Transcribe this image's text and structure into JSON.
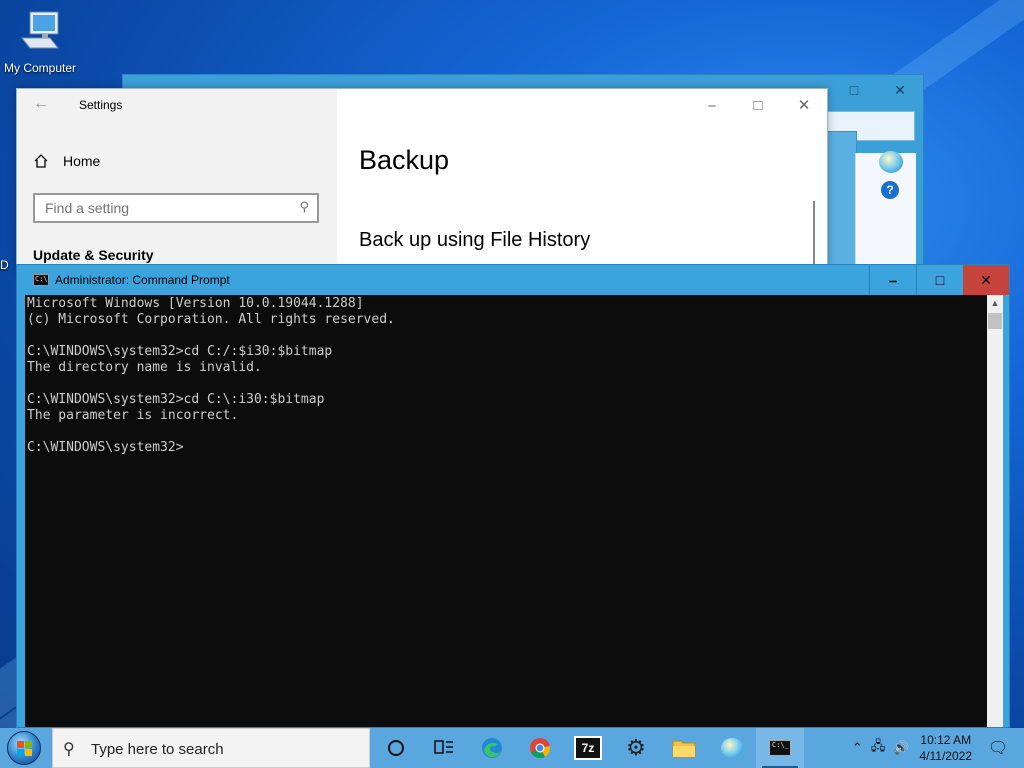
{
  "desktop": {
    "icons": [
      {
        "label": "My Computer",
        "icon": "computer-icon"
      }
    ],
    "partial_label": "D"
  },
  "background_window": {
    "icons": [
      "minimize-icon",
      "maximize-icon",
      "close-icon",
      "globe-icon",
      "help-icon"
    ],
    "help_glyph": "?"
  },
  "settings": {
    "title": "Settings",
    "nav_home": "Home",
    "search_placeholder": "Find a setting",
    "section": "Update & Security",
    "page_heading": "Backup",
    "subheading": "Back up using File History"
  },
  "cmd": {
    "title": "Administrator: Command Prompt",
    "lines": [
      "Microsoft Windows [Version 10.0.19044.1288]",
      "(c) Microsoft Corporation. All rights reserved.",
      "",
      "C:\\WINDOWS\\system32>cd C:/:$i30:$bitmap",
      "The directory name is invalid.",
      "",
      "C:\\WINDOWS\\system32>cd C:\\:i30:$bitmap",
      "The parameter is incorrect.",
      "",
      "C:\\WINDOWS\\system32>"
    ]
  },
  "taskbar": {
    "search_placeholder": "Type here to search",
    "pinned": [
      {
        "name": "cortana",
        "icon": "circle-icon"
      },
      {
        "name": "task-view",
        "icon": "task-view-icon"
      },
      {
        "name": "edge",
        "icon": "edge-icon"
      },
      {
        "name": "chrome",
        "icon": "chrome-icon"
      },
      {
        "name": "7zip",
        "icon": "7zip-icon",
        "text": "7z"
      },
      {
        "name": "settings",
        "icon": "gear-icon"
      },
      {
        "name": "file-explorer",
        "icon": "folder-icon"
      },
      {
        "name": "network-globe",
        "icon": "globe-icon"
      },
      {
        "name": "command-prompt",
        "icon": "cmd-icon",
        "active": true
      }
    ],
    "tray": {
      "time": "10:12 AM",
      "date": "4/11/2022"
    }
  },
  "colors": {
    "accent": "#3ba3dd",
    "close_red": "#c7433d",
    "console_bg": "#0c0c0c",
    "console_fg": "#cccccc"
  }
}
